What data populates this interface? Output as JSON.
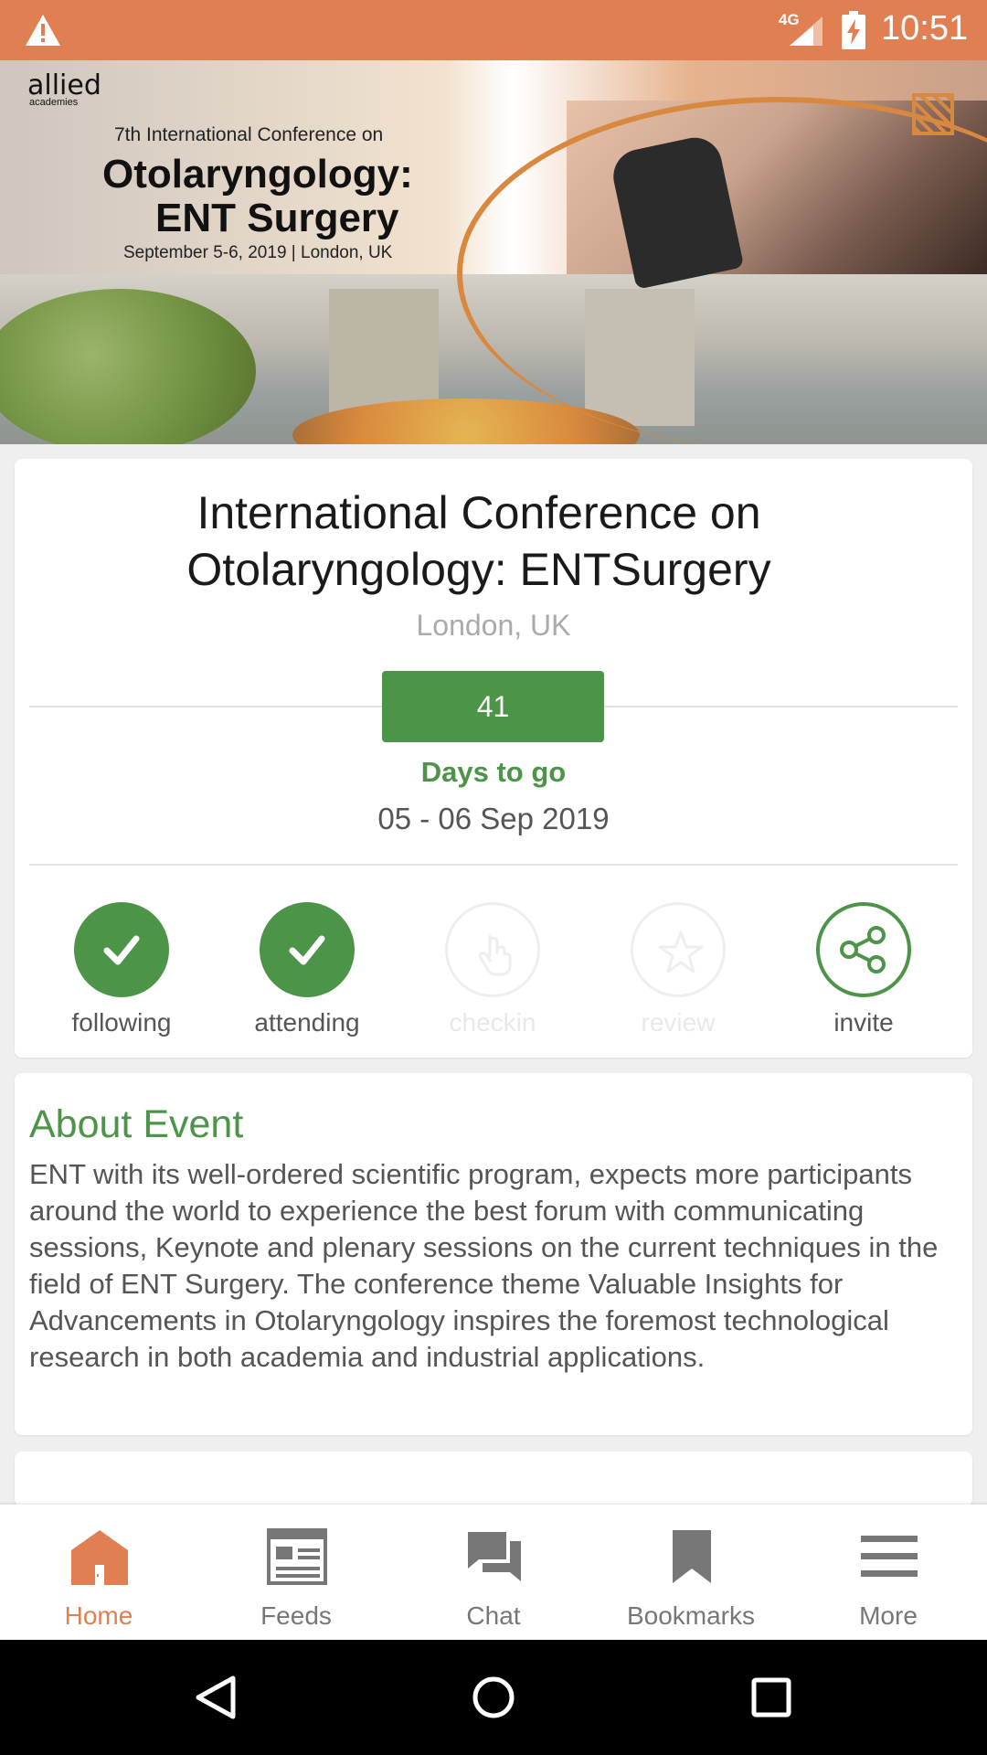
{
  "status_bar": {
    "network": "4G",
    "time": "10:51"
  },
  "banner": {
    "brand": "allied",
    "brand_sub": "academies",
    "edition": "7th International Conference on",
    "title_line1": "Otolaryngology:",
    "title_line2": "ENT Surgery",
    "date_place": "September 5-6, 2019 | London, UK"
  },
  "event": {
    "title_line1": "International Conference on",
    "title_line2": "Otolaryngology: ENTSurgery",
    "location": "London, UK",
    "countdown": "41",
    "countdown_label": "Days to go",
    "dates": "05 - 06 Sep 2019"
  },
  "actions": [
    {
      "label": "following",
      "state": "active",
      "icon": "check-icon"
    },
    {
      "label": "attending",
      "state": "active",
      "icon": "check-icon"
    },
    {
      "label": "checkin",
      "state": "disabled",
      "icon": "hand-pointer-icon"
    },
    {
      "label": "review",
      "state": "disabled",
      "icon": "star-icon"
    },
    {
      "label": "invite",
      "state": "enabled",
      "icon": "share-icon"
    }
  ],
  "about": {
    "heading": "About Event",
    "text": "ENT with its well-ordered scientific program, expects more participants around the world to experience the best forum with communicating sessions, Keynote and plenary sessions on the current techniques in the field of ENT Surgery. The conference theme Valuable Insights for Advancements in Otolaryngology inspires the foremost technological research in both academia and industrial applications."
  },
  "bottom_nav": [
    {
      "label": "Home",
      "icon": "home-icon",
      "active": true
    },
    {
      "label": "Feeds",
      "icon": "feeds-icon",
      "active": false
    },
    {
      "label": "Chat",
      "icon": "chat-icon",
      "active": false
    },
    {
      "label": "Bookmarks",
      "icon": "bookmark-icon",
      "active": false
    },
    {
      "label": "More",
      "icon": "menu-icon",
      "active": false
    }
  ],
  "colors": {
    "accent": "#e07f52",
    "green": "#4b9448"
  }
}
